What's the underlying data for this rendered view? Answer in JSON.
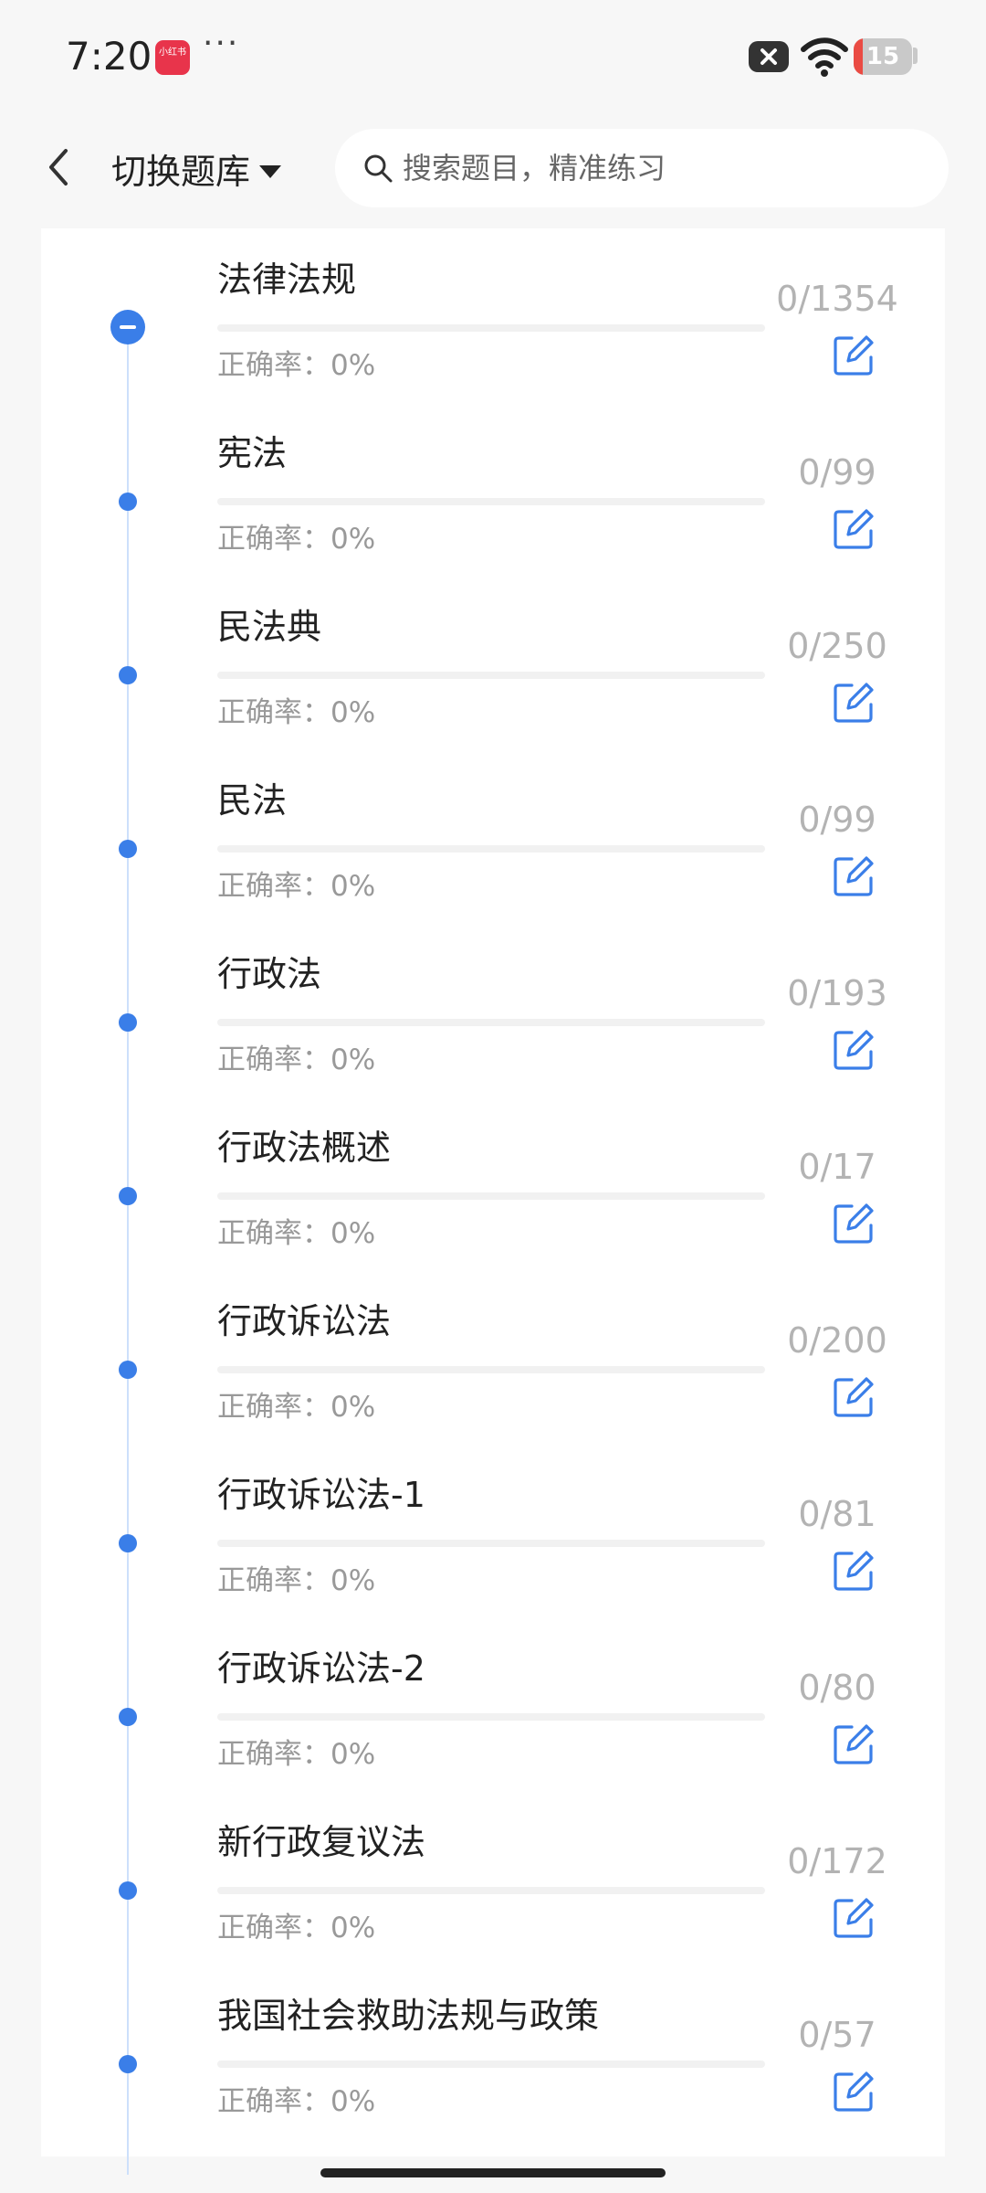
{
  "status_bar": {
    "time": "7:20",
    "app_badge": "小红书",
    "more": "···",
    "battery_percent": "15",
    "battery_level": 0.15,
    "accent_color": "#ea4b43"
  },
  "header": {
    "back_icon": "chevron-left-icon",
    "switch_label": "切换题库",
    "caret_icon": "caret-down-icon",
    "search_placeholder": "搜索题目，精准练习",
    "search_icon": "search-icon"
  },
  "colors": {
    "primary": "#3a7ee8",
    "timeline": "#cde0fb",
    "muted_text": "#999999",
    "count_text": "#b3b3b3",
    "track": "#f1f1f1"
  },
  "items": [
    {
      "title": "法律法规",
      "count": "0/1354",
      "accuracy_text": "正确率：0%",
      "progress": 0,
      "node": "minus-circle-icon"
    },
    {
      "title": "宪法",
      "count": "0/99",
      "accuracy_text": "正确率：0%",
      "progress": 0,
      "node": "dot-icon"
    },
    {
      "title": "民法典",
      "count": "0/250",
      "accuracy_text": "正确率：0%",
      "progress": 0,
      "node": "dot-icon"
    },
    {
      "title": "民法",
      "count": "0/99",
      "accuracy_text": "正确率：0%",
      "progress": 0,
      "node": "dot-icon"
    },
    {
      "title": "行政法",
      "count": "0/193",
      "accuracy_text": "正确率：0%",
      "progress": 0,
      "node": "dot-icon"
    },
    {
      "title": "行政法概述",
      "count": "0/17",
      "accuracy_text": "正确率：0%",
      "progress": 0,
      "node": "dot-icon"
    },
    {
      "title": "行政诉讼法",
      "count": "0/200",
      "accuracy_text": "正确率：0%",
      "progress": 0,
      "node": "dot-icon"
    },
    {
      "title": "行政诉讼法-1",
      "count": "0/81",
      "accuracy_text": "正确率：0%",
      "progress": 0,
      "node": "dot-icon"
    },
    {
      "title": "行政诉讼法-2",
      "count": "0/80",
      "accuracy_text": "正确率：0%",
      "progress": 0,
      "node": "dot-icon"
    },
    {
      "title": "新行政复议法",
      "count": "0/172",
      "accuracy_text": "正确率：0%",
      "progress": 0,
      "node": "dot-icon"
    },
    {
      "title": "我国社会救助法规与政策",
      "count": "0/57",
      "accuracy_text": "正确率：0%",
      "progress": 0,
      "node": "dot-icon"
    }
  ]
}
